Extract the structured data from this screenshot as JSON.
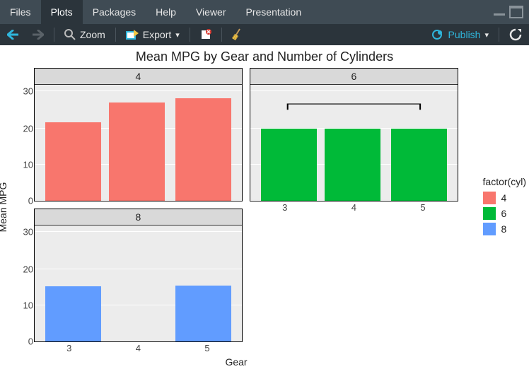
{
  "tabs": {
    "items": [
      "Files",
      "Plots",
      "Packages",
      "Help",
      "Viewer",
      "Presentation"
    ],
    "active_index": 1
  },
  "toolbar": {
    "zoom": "Zoom",
    "export": "Export",
    "publish": "Publish"
  },
  "chart_data": {
    "type": "bar",
    "title": "Mean MPG by Gear and Number of Cylinders",
    "xlabel": "Gear",
    "ylabel": "Mean MPG",
    "facet_var": "cyl",
    "legend_title": "factor(cyl)",
    "yticks": [
      0,
      10,
      20,
      30
    ],
    "ylim": [
      0,
      32
    ],
    "categories": [
      "3",
      "4",
      "5"
    ],
    "series_colors": {
      "4": "#f8766d",
      "6": "#00ba38",
      "8": "#619cff"
    },
    "facets": [
      {
        "label": "4",
        "values": [
          21.5,
          26.9,
          28.2
        ]
      },
      {
        "label": "6",
        "values": [
          19.7,
          19.7,
          19.7
        ]
      },
      {
        "label": "8",
        "values": [
          15.1,
          null,
          15.4
        ]
      }
    ],
    "legend_items": [
      "4",
      "6",
      "8"
    ]
  }
}
